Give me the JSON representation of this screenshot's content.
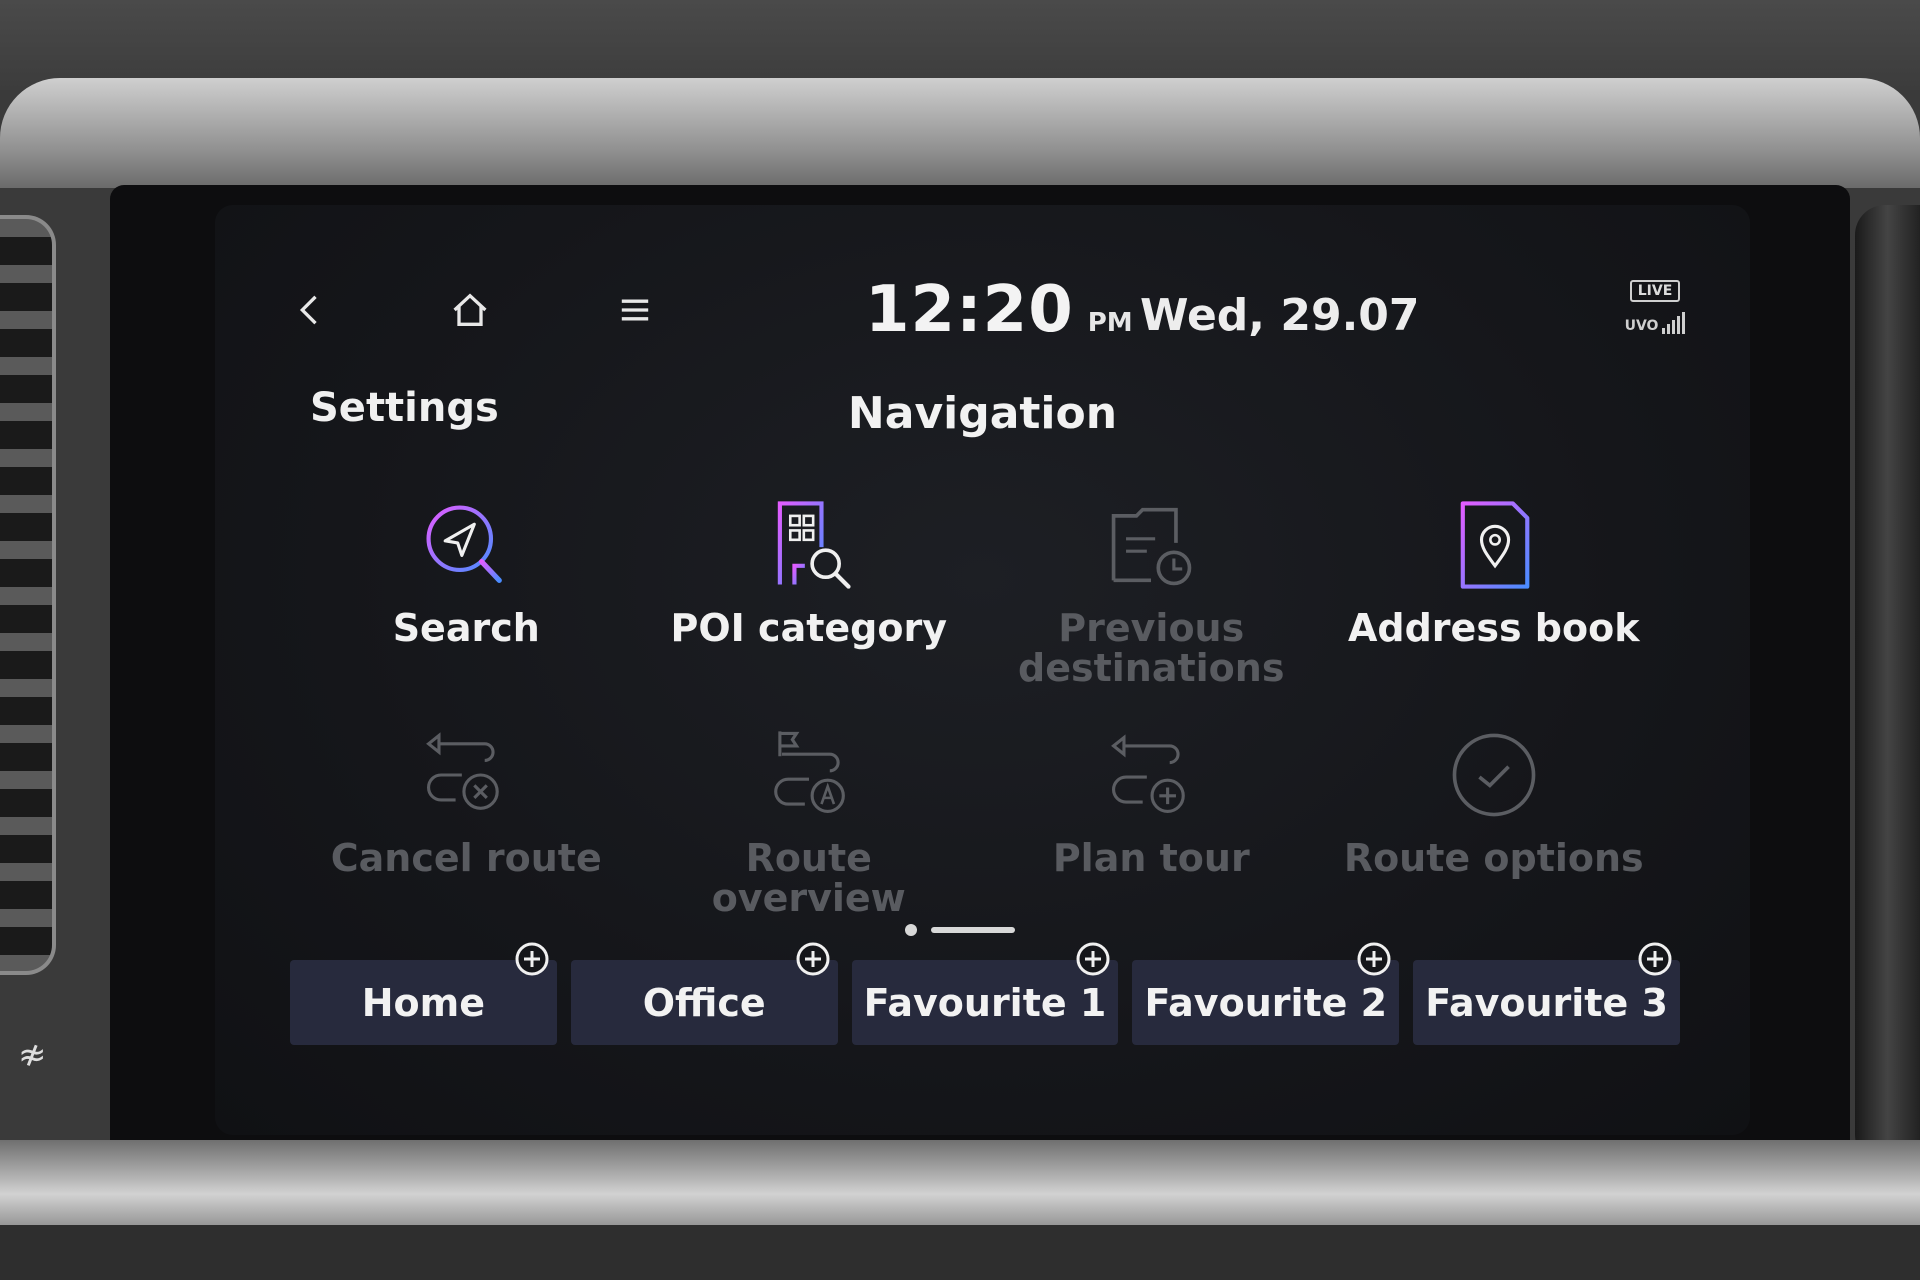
{
  "header": {
    "time": "12:20",
    "ampm": "PM",
    "date": "Wed, 29.07",
    "live_badge": "LIVE",
    "uvo_label": "UVO"
  },
  "nav": {
    "back_icon": "chevron-left-icon",
    "home_icon": "home-icon",
    "menu_icon": "menu-icon"
  },
  "settings_label": "Settings",
  "page_title": "Navigation",
  "tiles": [
    {
      "label": "Search",
      "icon": "search-navigate-icon",
      "enabled": true
    },
    {
      "label": "POI category",
      "icon": "poi-building-search-icon",
      "enabled": true
    },
    {
      "label": "Previous destinations",
      "icon": "folder-clock-icon",
      "enabled": false
    },
    {
      "label": "Address book",
      "icon": "address-book-pin-icon",
      "enabled": true
    },
    {
      "label": "Cancel route",
      "icon": "cancel-route-icon",
      "enabled": false
    },
    {
      "label": "Route overview",
      "icon": "route-overview-icon",
      "enabled": false
    },
    {
      "label": "Plan tour",
      "icon": "plan-tour-icon",
      "enabled": false
    },
    {
      "label": "Route options",
      "icon": "check-circle-icon",
      "enabled": false
    }
  ],
  "pager": {
    "pages": 2,
    "current": 2
  },
  "favourites": [
    {
      "label": "Home"
    },
    {
      "label": "Office"
    },
    {
      "label": "Favourite 1"
    },
    {
      "label": "Favourite 2"
    },
    {
      "label": "Favourite 3"
    }
  ],
  "colors": {
    "accent_gradient_start": "#e35cff",
    "accent_gradient_end": "#4a8cff",
    "favourite_bg": "#272a3d",
    "disabled_text": "#595b60"
  }
}
